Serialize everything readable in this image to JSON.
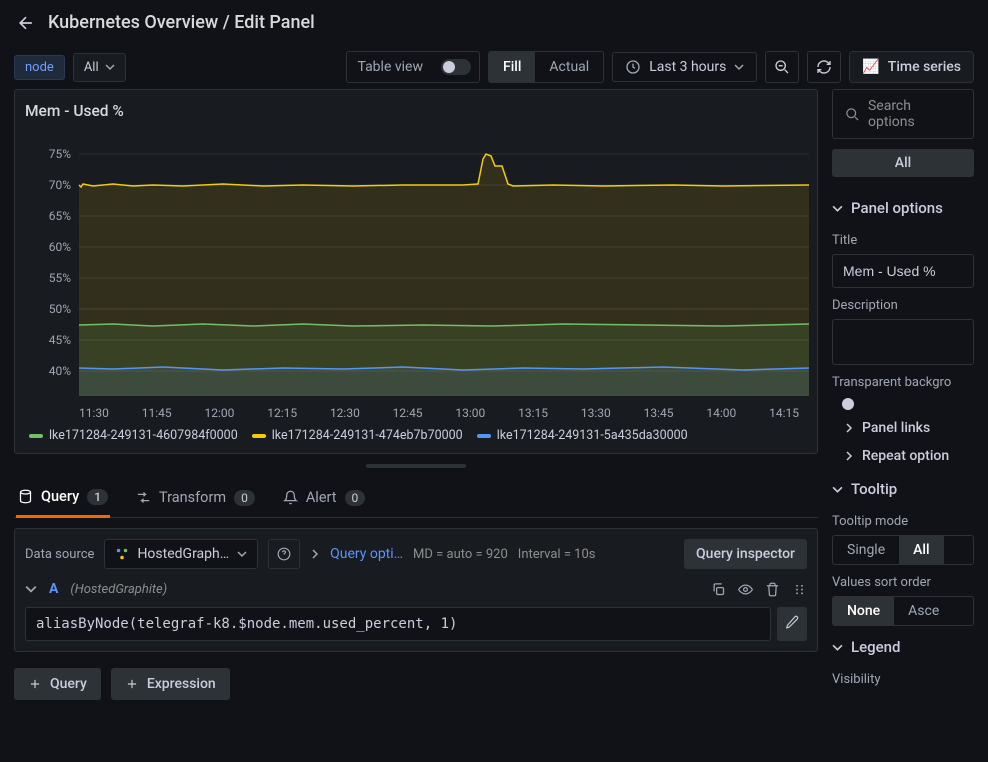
{
  "page": {
    "title": "Kubernetes Overview / Edit Panel"
  },
  "toolbar": {
    "var_name": "node",
    "var_value": "All",
    "table_view_label": "Table view",
    "fill_label": "Fill",
    "actual_label": "Actual",
    "time_range": "Last 3 hours",
    "vis_type": "Time series"
  },
  "panel": {
    "title": "Mem - Used %"
  },
  "chart_data": {
    "type": "line",
    "ylabel": "",
    "ylim": [
      38,
      75
    ],
    "yticks": [
      "75%",
      "70%",
      "65%",
      "60%",
      "55%",
      "50%",
      "45%",
      "40%"
    ],
    "categories": [
      "11:30",
      "11:45",
      "12:00",
      "12:15",
      "12:30",
      "12:45",
      "13:00",
      "13:15",
      "13:30",
      "13:45",
      "14:00",
      "14:15"
    ],
    "series": [
      {
        "name": "lke171284-249131-4607984f0000",
        "color": "#73BF69",
        "values": [
          47,
          47,
          47,
          47,
          47,
          47,
          47,
          47,
          47,
          47,
          47,
          47
        ]
      },
      {
        "name": "lke171284-249131-474eb7b70000",
        "color": "#F2CC0C",
        "values": [
          70,
          70,
          70,
          70,
          70,
          70,
          74,
          70,
          70,
          70,
          70,
          70
        ]
      },
      {
        "name": "lke171284-249131-5a435da30000",
        "color": "#5794F2",
        "values": [
          40,
          40,
          40,
          40,
          40,
          40,
          40,
          40,
          40,
          40,
          40,
          40
        ]
      }
    ]
  },
  "tabs": {
    "query_label": "Query",
    "query_count": "1",
    "transform_label": "Transform",
    "transform_count": "0",
    "alert_label": "Alert",
    "alert_count": "0"
  },
  "query": {
    "datasource_label": "Data source",
    "datasource": "HostedGraph…",
    "options_label": "Query opti…",
    "md": "MD = auto = 920",
    "interval": "Interval = 10s",
    "inspector_label": "Query inspector",
    "letter": "A",
    "hint": "(HostedGraphite)",
    "text": "aliasByNode(telegraf-k8.$node.mem.used_percent, 1)",
    "add_query": "Query",
    "add_expression": "Expression"
  },
  "sidebar": {
    "search_placeholder": "Search options",
    "all_label": "All",
    "panel_options": "Panel options",
    "title_label": "Title",
    "title_value": "Mem - Used %",
    "description_label": "Description",
    "transparent_label": "Transparent backgro",
    "panel_links": "Panel links",
    "repeat_options": "Repeat option",
    "tooltip": "Tooltip",
    "tooltip_mode_label": "Tooltip mode",
    "tooltip_single": "Single",
    "tooltip_all": "All",
    "sort_label": "Values sort order",
    "sort_none": "None",
    "sort_asc": "Asce",
    "legend": "Legend",
    "visibility": "Visibility"
  }
}
